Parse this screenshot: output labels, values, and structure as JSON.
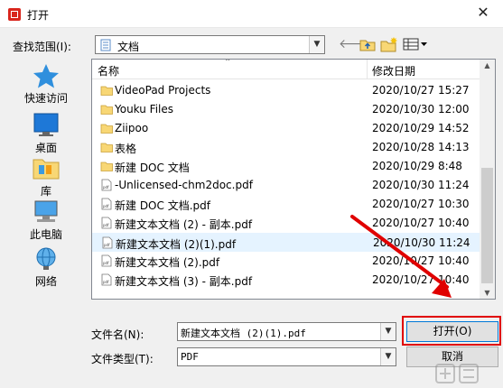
{
  "window": {
    "title": "打开",
    "close_glyph": "✕"
  },
  "look_in": {
    "label": "查找范围(I):",
    "value": "文档",
    "icon": "documents-folder-icon"
  },
  "toolbar": {
    "back_icon": "back-arrow-icon",
    "up_icon": "up-folder-icon",
    "new_folder_icon": "new-folder-icon",
    "view_menu_icon": "view-menu-icon"
  },
  "places": [
    {
      "label": "快速访问",
      "icon": "star-icon"
    },
    {
      "label": "桌面",
      "icon": "desktop-icon"
    },
    {
      "label": "库",
      "icon": "library-icon"
    },
    {
      "label": "此电脑",
      "icon": "computer-icon"
    },
    {
      "label": "网络",
      "icon": "network-icon"
    }
  ],
  "file_list": {
    "columns": {
      "name": "名称",
      "modified": "修改日期"
    },
    "rows": [
      {
        "name": "VideoPad Projects",
        "date": "2020/10/27 15:27",
        "type": "folder"
      },
      {
        "name": "Youku Files",
        "date": "2020/10/30 12:00",
        "type": "folder"
      },
      {
        "name": "Ziipoo",
        "date": "2020/10/29 14:52",
        "type": "folder"
      },
      {
        "name": "表格",
        "date": "2020/10/28 14:13",
        "type": "folder"
      },
      {
        "name": "新建 DOC 文档",
        "date": "2020/10/29 8:48",
        "type": "folder"
      },
      {
        "name": "-Unlicensed-chm2doc.pdf",
        "date": "2020/10/30 11:24",
        "type": "pdf"
      },
      {
        "name": "新建 DOC 文档.pdf",
        "date": "2020/10/27 10:30",
        "type": "pdf"
      },
      {
        "name": "新建文本文档 (2) - 副本.pdf",
        "date": "2020/10/27 10:40",
        "type": "pdf"
      },
      {
        "name": "新建文本文档 (2)(1).pdf",
        "date": "2020/10/30 11:24",
        "type": "pdf",
        "selected": true
      },
      {
        "name": "新建文本文档 (2).pdf",
        "date": "2020/10/27 10:40",
        "type": "pdf"
      },
      {
        "name": "新建文本文档 (3) - 副本.pdf",
        "date": "2020/10/27 10:40",
        "type": "pdf"
      }
    ]
  },
  "filename": {
    "label": "文件名(N):",
    "value": "新建文本文档 (2)(1).pdf"
  },
  "filetype": {
    "label": "文件类型(T):",
    "value": "PDF"
  },
  "buttons": {
    "open": "打开(O)",
    "cancel": "取消"
  },
  "colors": {
    "annotation_red": "#e00000",
    "selection": "#e5f3ff",
    "folder_yellow": "#f8d775"
  }
}
